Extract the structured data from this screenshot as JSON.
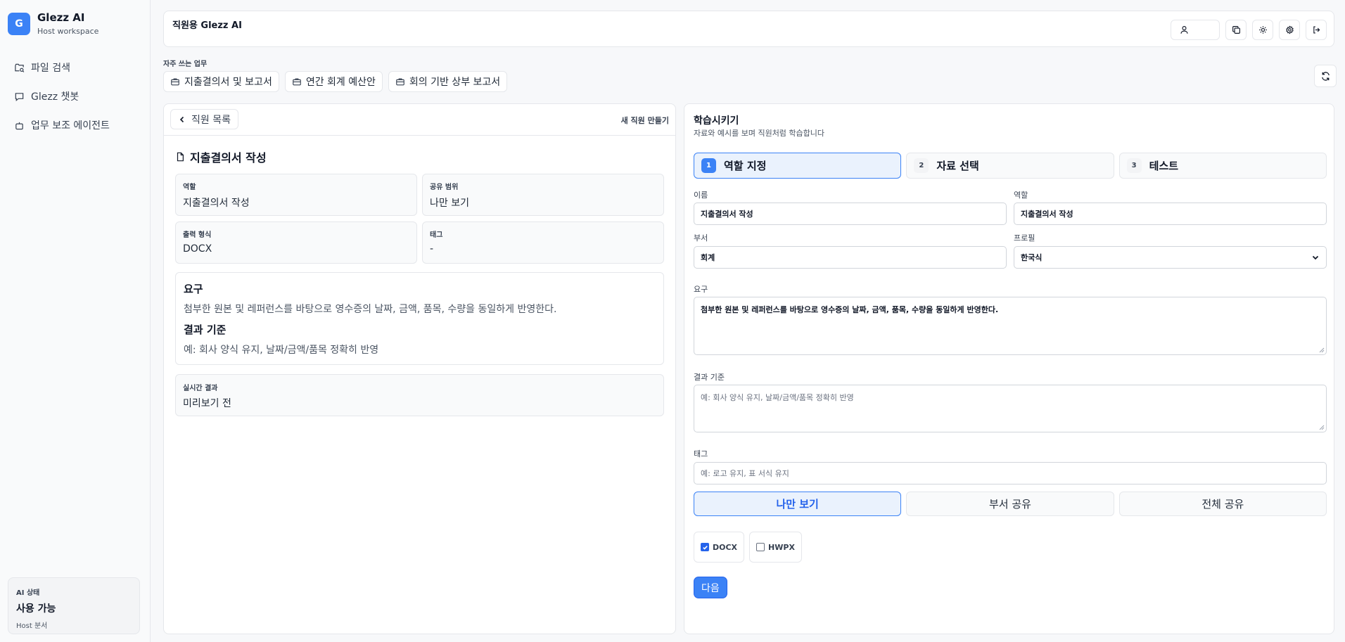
{
  "brand": {
    "logo_letter": "G",
    "name": "Glezz AI",
    "subtitle": "Host workspace"
  },
  "sidebar": {
    "items": [
      {
        "label": "파일 검색",
        "icon": "folder-search-icon"
      },
      {
        "label": "Glezz 챗봇",
        "icon": "chat-icon"
      },
      {
        "label": "업무 보조 에이전트",
        "icon": "bot-icon"
      }
    ]
  },
  "ai_status": {
    "title": "AI 상태",
    "value": "사용 가능",
    "sub": "Host 분서"
  },
  "header": {
    "title": "직원용 Glezz AI",
    "actions": [
      "user-icon",
      "copy-icon",
      "sun-icon",
      "gear-icon",
      "logout-icon"
    ]
  },
  "quick_tasks": {
    "label": "자주 쓰는 업무",
    "items": [
      "지출결의서 및 보고서",
      "연간 회계 예산안",
      "회의 기반 상부 보고서"
    ]
  },
  "left_panel": {
    "back_label": "직원 목록",
    "new_label": "새 직원 만들기",
    "doc_title": "지출결의서 작성",
    "cards": [
      {
        "key": "역할",
        "value": "지출결의서 작성"
      },
      {
        "key": "공유 범위",
        "value": "나만 보기"
      },
      {
        "key": "출력 형식",
        "value": "DOCX"
      },
      {
        "key": "태그",
        "value": "-"
      }
    ],
    "requirement": {
      "heading": "요구",
      "text": "첨부한 원본 및 레퍼런스를 바탕으로 영수증의 날짜, 금액, 품목, 수량을 동일하게 반영한다.",
      "criteria_heading": "결과 기준",
      "criteria_text": "예: 회사 양식 유지, 날짜/금액/품목 정확히 반영"
    },
    "live": {
      "key": "실시간 결과",
      "value": "미리보기 전"
    }
  },
  "right_panel": {
    "title": "학습시키기",
    "subtitle": "자료와 예시를 보며 직원처럼 학습합니다",
    "steps": [
      {
        "num": "1",
        "label": "역할 지정",
        "active": true
      },
      {
        "num": "2",
        "label": "자료 선택",
        "active": false
      },
      {
        "num": "3",
        "label": "테스트",
        "active": false
      }
    ],
    "fields": {
      "name_label": "이름",
      "name_value": "지출결의서 작성",
      "role_label": "역할",
      "role_value": "지출결의서 작성",
      "dept_label": "부서",
      "dept_value": "회계",
      "profile_label": "프로필",
      "profile_value": "한국식",
      "req_label": "요구",
      "req_value": "첨부한 원본 및 레퍼런스를 바탕으로 영수증의 날짜, 금액, 품목, 수량을 동일하게 반영한다.",
      "criteria_label": "결과 기준",
      "criteria_placeholder": "예: 회사 양식 유지, 날짜/금액/품목 정확히 반영",
      "tag_label": "태그",
      "tag_placeholder": "예: 로고 유지, 표 서식 유지"
    },
    "share": [
      {
        "label": "나만 보기",
        "active": true
      },
      {
        "label": "부서 공유",
        "active": false
      },
      {
        "label": "전체 공유",
        "active": false
      }
    ],
    "formats": [
      {
        "label": "DOCX",
        "checked": true
      },
      {
        "label": "HWPX",
        "checked": false
      }
    ],
    "next_label": "다음"
  },
  "colors": {
    "accent": "#3b82f6",
    "accent_light": "#eaf2fd",
    "border": "#e5e7eb"
  }
}
